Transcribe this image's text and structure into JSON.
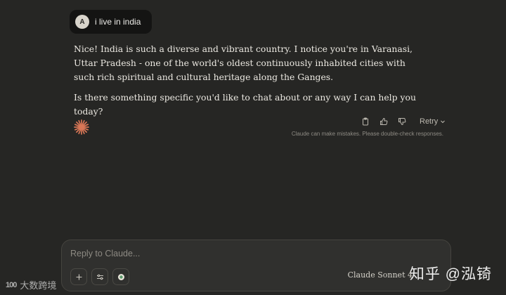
{
  "user_message": {
    "avatar_initial": "A",
    "text": "i live in india"
  },
  "assistant_message": {
    "paragraphs": [
      "Nice! India is such a diverse and vibrant country. I notice you're in Varanasi, Uttar Pradesh - one of the world's oldest continuously inhabited cities with such rich spiritual and cultural heritage along the Ganges.",
      "Is there something specific you'd like to chat about or any way I can help you today?"
    ]
  },
  "message_actions": {
    "copy_icon": "copy-icon",
    "thumbs_up_icon": "thumbs-up-icon",
    "thumbs_down_icon": "thumbs-down-icon",
    "retry_label": "Retry"
  },
  "disclaimer": "Claude can make mistakes. Please double-check responses.",
  "composer": {
    "placeholder": "Reply to Claude...",
    "tools": [
      "plus-icon",
      "sliders-icon",
      "tool-status-icon"
    ],
    "model_label": "Claude Sonnet 4"
  },
  "watermarks": {
    "left_logo": "100",
    "left_text": "大数跨境",
    "right_text": "知乎 @泓锜"
  },
  "colors": {
    "background": "#262624",
    "user_bubble": "#141413",
    "composer_bg": "#30302e",
    "spark_accent": "#d97757"
  }
}
